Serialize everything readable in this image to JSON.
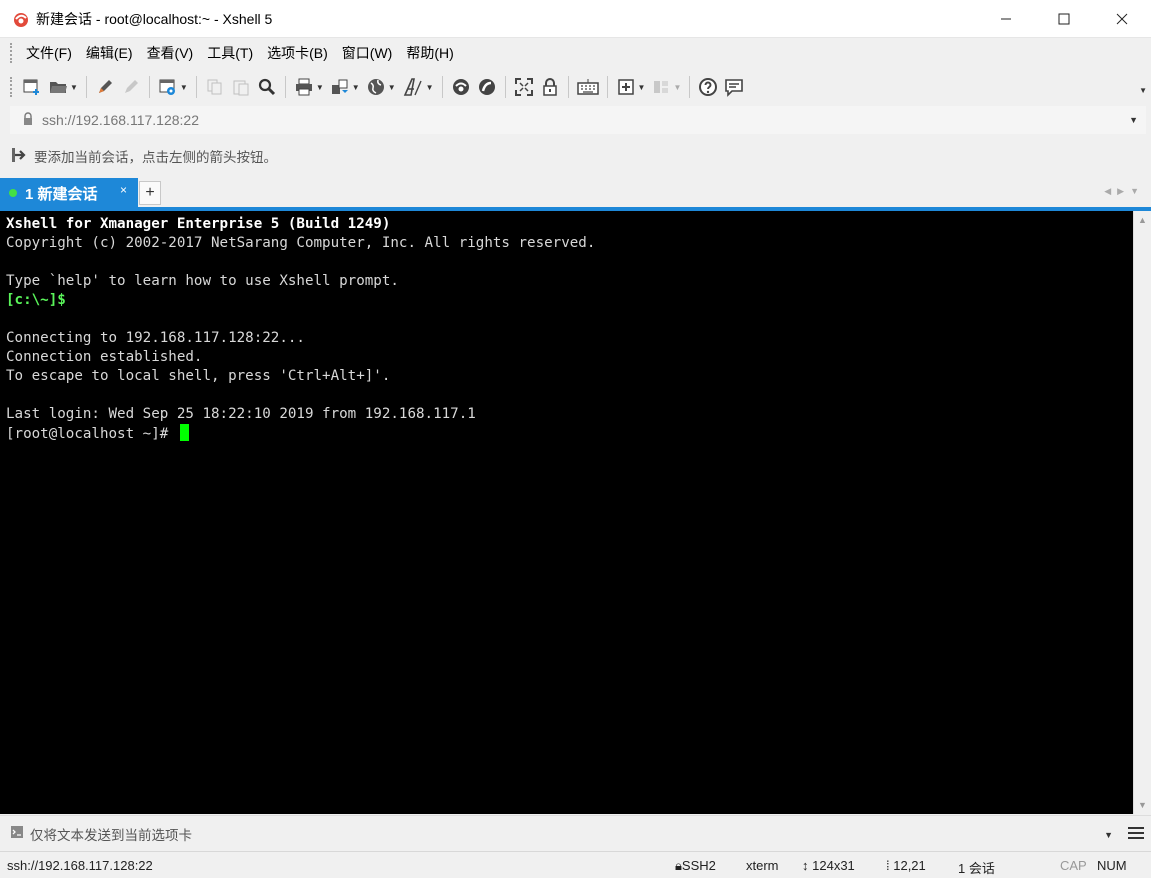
{
  "window": {
    "title": "新建会话 - root@localhost:~ - Xshell 5",
    "app_icon": "xshell-logo-icon",
    "controls": [
      "minimize-icon",
      "maximize-icon",
      "close-icon"
    ]
  },
  "menu": {
    "items": [
      "文件(F)",
      "编辑(E)",
      "查看(V)",
      "工具(T)",
      "选项卡(B)",
      "窗口(W)",
      "帮助(H)"
    ]
  },
  "toolbar": {
    "icons": [
      "new-session-icon",
      "open-folder-icon",
      "pencil-icon",
      "disconnect-icon",
      "properties-icon",
      "copy-icon",
      "paste-icon",
      "find-icon",
      "print-icon",
      "transfer-icon",
      "globe-icon",
      "font-icon",
      "xftp-icon",
      "xagent-icon",
      "fullscreen-icon",
      "lock-icon",
      "keyboard-icon",
      "new-tab-icon",
      "layout-icon",
      "help-icon",
      "chat-icon"
    ]
  },
  "address": {
    "value": "ssh://192.168.117.128:22"
  },
  "hint": {
    "text": "要添加当前会话，点击左侧的箭头按钮。"
  },
  "tabs": {
    "active_label": "1 新建会话",
    "close_glyph": "×",
    "add_glyph": "+",
    "status_color": "#44e044"
  },
  "terminal": {
    "lines": [
      "Xshell for Xmanager Enterprise 5 (Build 1249)",
      "Copyright (c) 2002-2017 NetSarang Computer, Inc. All rights reserved.",
      "",
      "Type `help' to learn how to use Xshell prompt.",
      "[c:\\~]$",
      "",
      "Connecting to 192.168.117.128:22...",
      "Connection established.",
      "To escape to local shell, press 'Ctrl+Alt+]'.",
      "",
      "Last login: Wed Sep 25 18:22:10 2019 from 192.168.117.1",
      "[root@localhost ~]# "
    ],
    "background": "#000000",
    "cursor_color": "#00ff00"
  },
  "send_bar": {
    "text": "仅将文本发送到当前选项卡"
  },
  "status": {
    "address": "ssh://192.168.117.128:22",
    "protocol": "SSH2",
    "terminal_type": "xterm",
    "size": "124x31",
    "cursor_pos": "12,21",
    "sessions": "1 会话",
    "cap": "CAP",
    "num": "NUM"
  },
  "colors": {
    "accent": "#1e88d8",
    "prompt_green": "#5af55a"
  }
}
